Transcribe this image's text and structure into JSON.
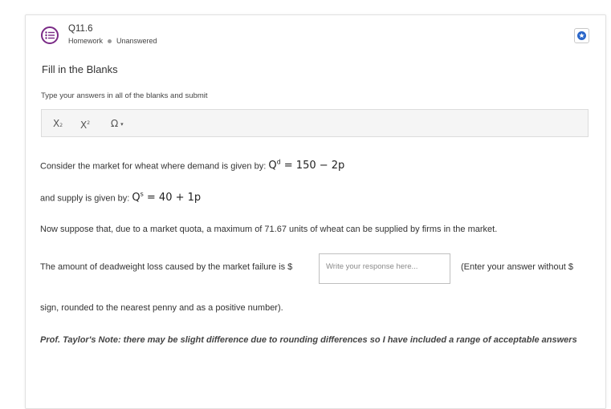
{
  "question": {
    "number": "Q11.6",
    "category": "Homework",
    "status": "Unanswered"
  },
  "title": "Fill in the Blanks",
  "instructions": "Type your answers in all of the blanks and submit",
  "toolbar": {
    "subscript_label": "X",
    "subscript_small": "2",
    "superscript_label": "X",
    "superscript_small": "2",
    "symbol_label": "Ω",
    "caret": "▾"
  },
  "body": {
    "demand_text": "Consider the market for wheat where demand is given by:",
    "demand_eq_q": "Q",
    "demand_eq_sup": "d",
    "demand_eq_rhs": " = 150 − 2p",
    "supply_text": "and supply is given by:",
    "supply_eq_q": "Q",
    "supply_eq_sup": "s",
    "supply_eq_rhs": " = 40 + 1p",
    "quota_text": "Now suppose that, due to a market quota, a maximum of 71.67 units of wheat can be supplied by firms in the market.",
    "dwl_text": "The amount of deadweight loss caused by the market failure is $",
    "response_placeholder": "Write your response here...",
    "after_blank": "(Enter your answer without $",
    "continuation": "sign, rounded to the nearest penny and as a positive number).",
    "note": "Prof. Taylor's Note: there may be slight difference due to rounding differences so I have included a range of acceptable answers"
  },
  "colors": {
    "icon_purple": "#7a2a86",
    "star_blue": "#2a66c9"
  }
}
